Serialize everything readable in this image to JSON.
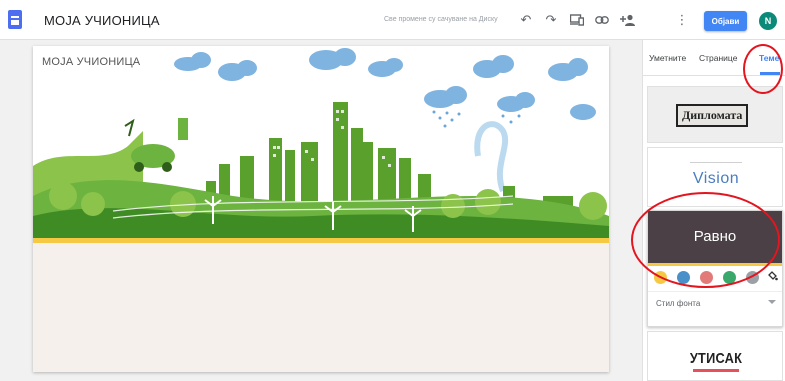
{
  "header": {
    "title": "МОЈА УЧИОНИЦА",
    "save_status": "Све промене су сачуване на Диску",
    "icons": [
      "undo-icon",
      "redo-icon",
      "preview-icon",
      "link-icon",
      "share-icon",
      "more-icon"
    ],
    "publish_label": "Објави",
    "avatar_letter": "N"
  },
  "canvas": {
    "site_title": "МОЈА УЧИОНИЦА"
  },
  "panel": {
    "tabs": [
      {
        "label": "Уметните",
        "active": false
      },
      {
        "label": "Странице",
        "active": false
      },
      {
        "label": "Теме",
        "active": true
      }
    ],
    "themes": {
      "diploma": "Дипломата",
      "vision": "Vision",
      "ravno": "Равно",
      "font_style_label": "Стил фонта",
      "utisak": "УТИСАК"
    },
    "swatches": [
      "#f6c945",
      "#4a90c8",
      "#e27a7a",
      "#3aa86b",
      "#9aa0a6"
    ]
  },
  "colors": {
    "accent": "#4285f4",
    "banner_green": "#6cb33f",
    "highlight_yellow": "#f6c945",
    "annotation_red": "#e3151f"
  }
}
